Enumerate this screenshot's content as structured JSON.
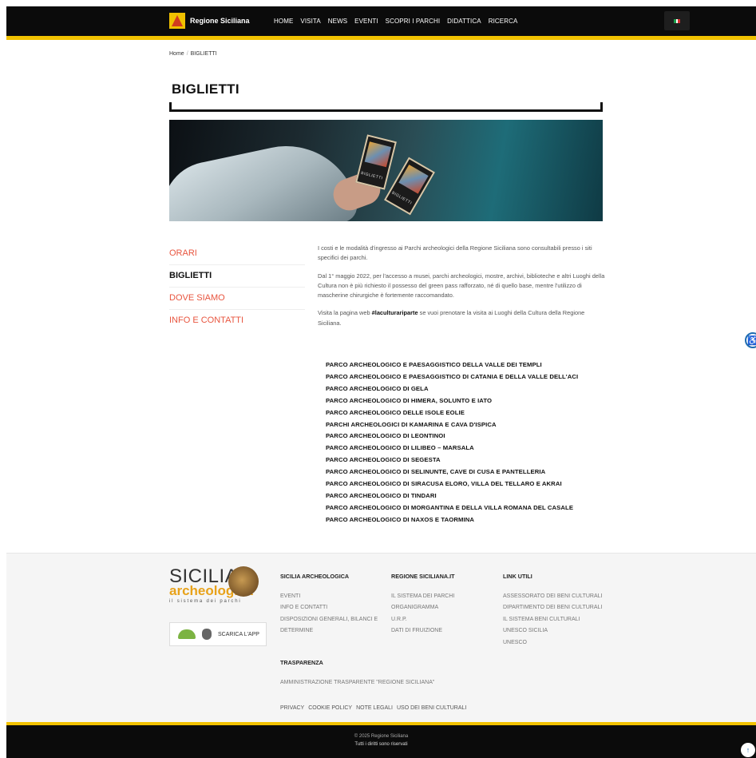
{
  "header": {
    "brand": "Regione Siciliana",
    "nav": [
      "HOME",
      "VISITA",
      "NEWS",
      "EVENTI",
      "SCOPRI I PARCHI",
      "DIDATTICA",
      "RICERCA"
    ],
    "language_icon": "italian-flag-icon"
  },
  "breadcrumb": {
    "home": "Home",
    "current": "BIGLIETTI"
  },
  "page": {
    "title": "BIGLIETTI"
  },
  "hero": {
    "image": "hand-holding-park-tickets",
    "ticket_label": "BIGLIETTI"
  },
  "sidebar": {
    "items": [
      {
        "label": "ORARI",
        "active": false
      },
      {
        "label": "BIGLIETTI",
        "active": true
      },
      {
        "label": "DOVE SIAMO",
        "active": false
      },
      {
        "label": "INFO E CONTATTI",
        "active": false
      }
    ]
  },
  "content": {
    "p1": "I costi e le modalità d'ingresso ai Parchi archeologici della Regione Siciliana sono consultabili presso i siti specifici dei parchi.",
    "p2": "Dal 1° maggio 2022, per l'accesso a musei, parchi archeologici, mostre, archivi, biblioteche e altri Luoghi della Cultura non è più richiesto il possesso del green pass rafforzato, né di quello base, mentre l'utilizzo di mascherine chirurgiche è fortemente raccomandato.",
    "p3_pre": "Visita la pagina web ",
    "p3_tag": "#laculturariparte",
    "p3_post": " se vuoi prenotare la visita ai Luoghi della Cultura della Regione Siciliana.",
    "parks": [
      "PARCO ARCHEOLOGICO E PAESAGGISTICO DELLA VALLE DEI TEMPLI",
      "PARCO ARCHEOLOGICO E PAESAGGISTICO DI CATANIA E DELLA VALLE DELL'ACI",
      "PARCO ARCHEOLOGICO DI GELA",
      "PARCO ARCHEOLOGICO DI HIMERA, SOLUNTO E IATO",
      "PARCO ARCHEOLOGICO DELLE ISOLE EOLIE",
      "PARCHI ARCHEOLOGICI DI KAMARINA E CAVA D'ISPICA",
      "PARCO ARCHEOLOGICO DI LEONTINOI",
      "PARCO ARCHEOLOGICO DI LILIBEO – MARSALA",
      "PARCO ARCHEOLOGICO DI SEGESTA",
      "PARCO ARCHEOLOGICO DI SELINUNTE, CAVE DI CUSA E PANTELLERIA",
      "PARCO ARCHEOLOGICO DI SIRACUSA ELORO, VILLA DEL TELLARO E AKRAI",
      "PARCO ARCHEOLOGICO DI TINDARI",
      "PARCO ARCHEOLOGICO DI MORGANTINA E DELLA VILLA ROMANA DEL CASALE",
      "PARCO ARCHEOLOGICO DI NAXOS E TAORMINA"
    ]
  },
  "footer": {
    "logo": {
      "line1": "SICILIA",
      "line2": "archeologica",
      "line3": "il sistema dei parchi"
    },
    "app_button": "SCARICA L'APP",
    "col1": {
      "title": "SICILIA ARCHEOLOGICA",
      "links": [
        "EVENTI",
        "INFO E CONTATTI",
        "DISPOSIZIONI GENERALI, BILANCI E DETERMINE"
      ]
    },
    "col2": {
      "title": "REGIONE SICILIANA.IT",
      "links": [
        "IL SISTEMA DEI PARCHI",
        "ORGANIGRAMMA",
        "U.R.P.",
        "DATI DI FRUIZIONE"
      ]
    },
    "col3": {
      "title": "LINK UTILI",
      "links": [
        "ASSESSORATO DEI BENI CULTURALI",
        "DIPARTIMENTO DEI BENI CULTURALI",
        "IL SISTEMA BENI CULTURALI",
        "UNESCO SICILIA",
        "UNESCO"
      ]
    },
    "col4": {
      "title": "TRASPARENZA",
      "links": [
        "AMMINISTRAZIONE TRASPARENTE \"REGIONE SICILIANA\""
      ]
    },
    "legal": [
      "PRIVACY",
      "COOKIE POLICY",
      "NOTE LEGALI",
      "USO DEI BENI CULTURALI"
    ],
    "copyright": "© 2025 Regione Siciliana",
    "rights": "Tutti i diritti sono riservati"
  },
  "colors": {
    "accent_yellow": "#f2c200",
    "link_orange": "#e8553f",
    "dark": "#0b0b0b"
  }
}
